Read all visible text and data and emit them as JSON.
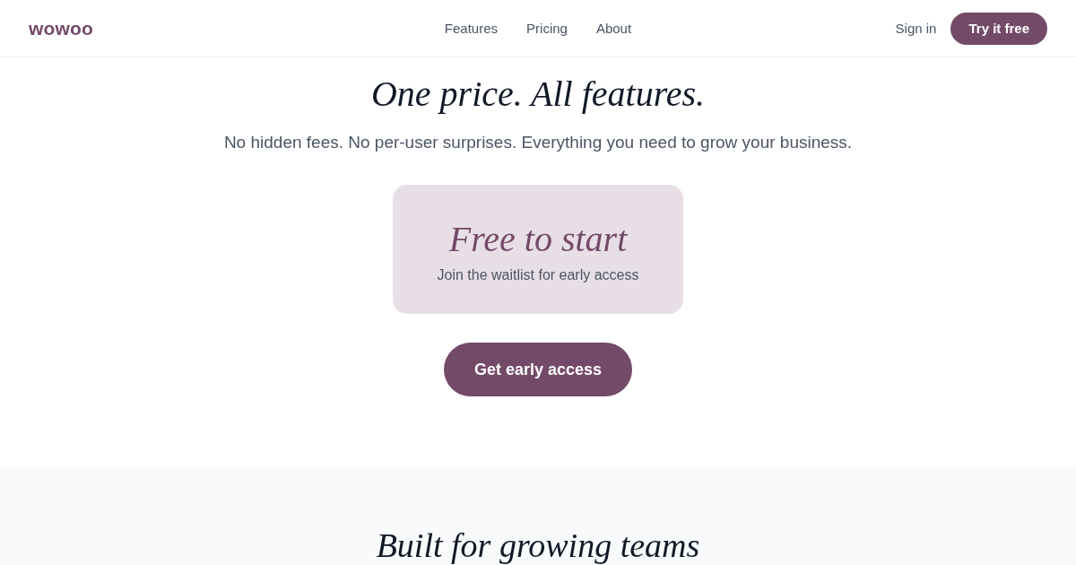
{
  "header": {
    "logo": "wowoo",
    "nav": [
      "Features",
      "Pricing",
      "About"
    ],
    "sign_in": "Sign in",
    "cta": "Try it free"
  },
  "hero": {
    "title": "One price. All features.",
    "subtitle": "No hidden fees. No per-user surprises. Everything you need to grow your business.",
    "card": {
      "title": "Free to start",
      "text": "Join the waitlist for early access"
    },
    "button": "Get early access"
  },
  "features": {
    "title": "Built for growing teams"
  }
}
